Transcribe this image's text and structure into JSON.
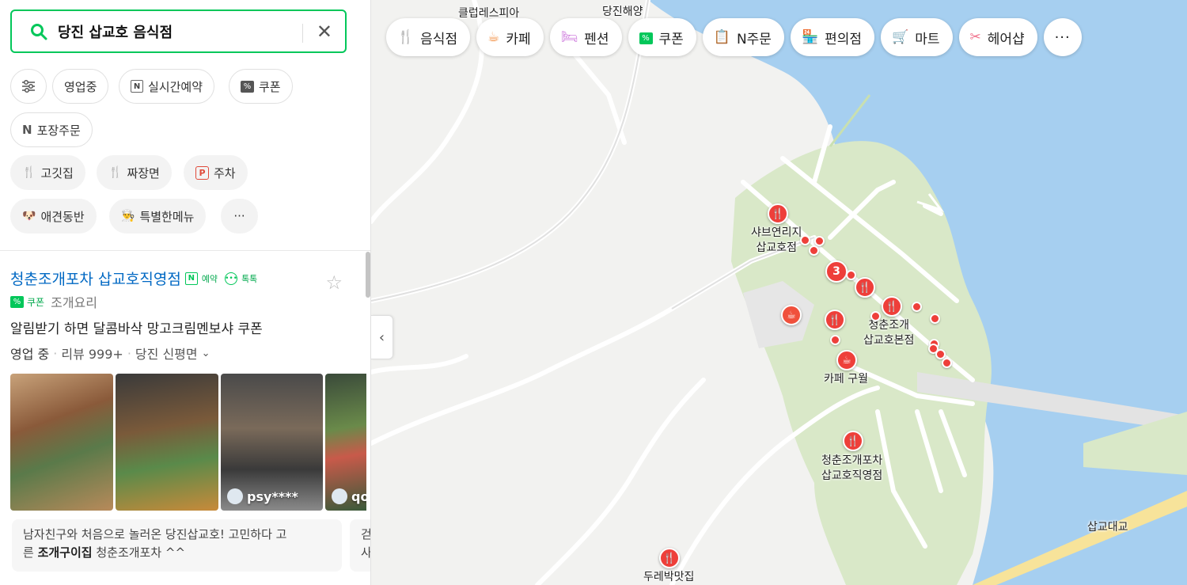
{
  "search": {
    "query": "당진 삽교호 음식점"
  },
  "filters": {
    "row1": [
      "영업중",
      "실시간예약",
      "쿠폰"
    ],
    "row2": [
      "포장주문"
    ],
    "row3": [
      "고깃집",
      "짜장면",
      "주차"
    ],
    "row4": [
      "애견동반",
      "특별한메뉴"
    ]
  },
  "categories": [
    {
      "label": "음식점",
      "icon": "fork-knife-icon",
      "color": "#f26b21"
    },
    {
      "label": "카페",
      "icon": "cup-icon",
      "color": "#f28b3c"
    },
    {
      "label": "펜션",
      "icon": "bed-icon",
      "color": "#c86ad9"
    },
    {
      "label": "쿠폰",
      "icon": "coupon-icon",
      "color": "#03c75a"
    },
    {
      "label": "N주문",
      "icon": "order-icon",
      "color": "#03c75a"
    },
    {
      "label": "편의점",
      "icon": "store-icon",
      "color": "#f2a516"
    },
    {
      "label": "마트",
      "icon": "cart-icon",
      "color": "#f2a516"
    },
    {
      "label": "헤어샵",
      "icon": "scissors-icon",
      "color": "#f0708a"
    }
  ],
  "result": {
    "title": "청춘조개포차 삽교호직영점",
    "badge_reserve": "예약",
    "badge_talk": "톡톡",
    "coupon": "쿠폰",
    "category": "조개요리",
    "promo": "알림받기 하면 달콤바삭 망고크림멘보샤 쿠폰",
    "status": "영업 중",
    "reviews": "리뷰 999+",
    "location": "당진 신평면",
    "photo_user1": "psy****",
    "photo_user2": "qo",
    "review_text_1": "남자친구와 처음으로 놀러온 당진삽교호! 고민하다 고",
    "review_text_2a": "른 ",
    "review_text_2b": "조개구이집",
    "review_text_2c": " 청춘조개포차 ^^",
    "review2_fragment_1": "걷",
    "review2_fragment_2": "사"
  },
  "map": {
    "labels": {
      "club": "클럽레스피아",
      "dangjin": "당진해양",
      "shabu_1": "샤브연리지",
      "shabu_2": "삽교호점",
      "chungchun_main_1": "청춘조개",
      "chungchun_main_2": "삽교호본점",
      "cafe": "카페 구월",
      "chungchun_direct_1": "청춘조개포차",
      "chungchun_direct_2": "삽교호직영점",
      "bridge": "삽교대교",
      "durebak": "두레박맛집"
    },
    "cluster_count": "3"
  },
  "colors": {
    "accent": "#03c75a",
    "pin": "#ee3f3a",
    "sea": "#a6cff0",
    "park": "#d9e8c8",
    "link": "#0068c3"
  }
}
